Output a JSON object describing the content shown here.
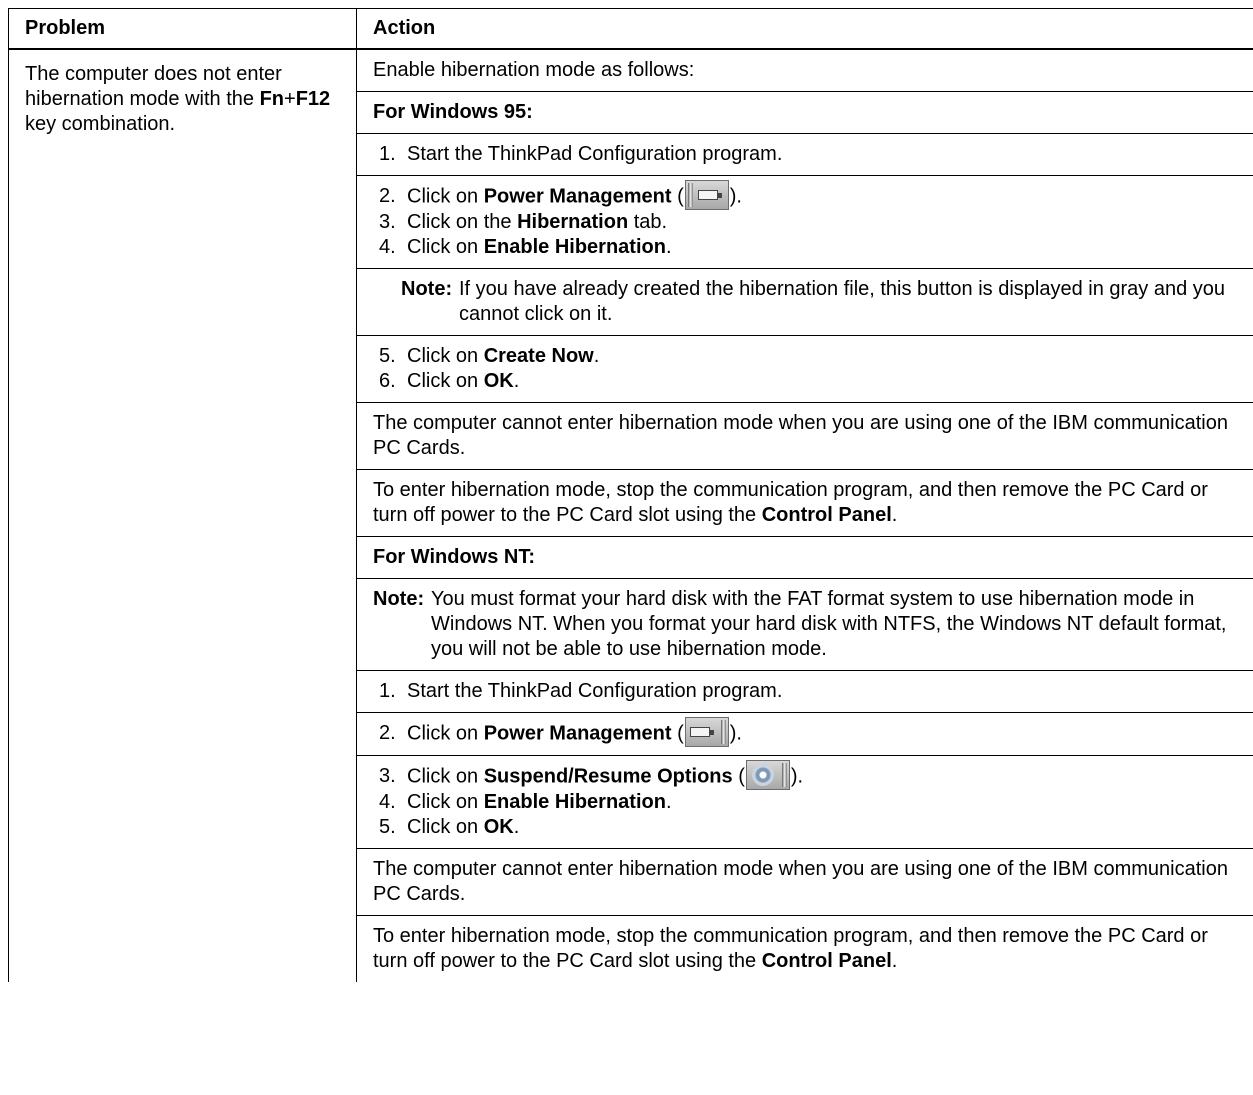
{
  "header": {
    "problem": "Problem",
    "action": "Action"
  },
  "problem": {
    "p1": "The computer does not enter hibernation mode with the ",
    "fn": "Fn",
    "plus": "+",
    "f12": "F12",
    "p2": " key combination."
  },
  "a1": {
    "text": "Enable hibernation mode as follows:"
  },
  "w95": {
    "heading": "For Windows 95:",
    "s1_num": "1.",
    "s1_text": "Start the ThinkPad Configuration program.",
    "s2_num": "2.",
    "s2_pre": "Click on ",
    "s2_bold": "Power Management",
    "s2_post_a": " (",
    "s2_post_b": ").",
    "s3_num": "3.",
    "s3_pre": "Click on the ",
    "s3_bold": "Hibernation",
    "s3_post": " tab.",
    "s4_num": "4.",
    "s4_pre": "Click on ",
    "s4_bold": "Enable Hibernation",
    "s4_post": ".",
    "note_label": "Note:",
    "note_text": "If you have already created the hibernation file, this button is displayed in gray and you cannot click on it.",
    "s5_num": "5.",
    "s5_pre": "Click on ",
    "s5_bold": "Create Now",
    "s5_post": ".",
    "s6_num": "6.",
    "s6_pre": "Click on ",
    "s6_bold": "OK",
    "s6_post": ".",
    "para1": "The computer cannot enter hibernation mode when you are using one of the IBM communication PC Cards.",
    "para2_pre": "To enter hibernation mode, stop the communication program, and then remove the PC Card or turn off power to the PC Card slot using the ",
    "para2_bold": "Control Panel",
    "para2_post": "."
  },
  "nt": {
    "heading": "For Windows NT:",
    "note_label": "Note:",
    "note_text": "You must format your hard disk with the FAT format system to use hibernation mode in Windows NT.  When you format your hard disk with NTFS, the Windows NT default format, you will not be able to use hibernation mode.",
    "s1_num": "1.",
    "s1_text": "Start the ThinkPad Configuration program.",
    "s2_num": "2.",
    "s2_pre": "Click on ",
    "s2_bold": "Power Management",
    "s2_post_a": " (",
    "s2_post_b": ").",
    "s3_num": "3.",
    "s3_pre": "Click on ",
    "s3_bold": "Suspend/Resume Options",
    "s3_post_a": " (",
    "s3_post_b": ").",
    "s4_num": "4.",
    "s4_pre": "Click on ",
    "s4_bold": "Enable Hibernation",
    "s4_post": ".",
    "s5_num": "5.",
    "s5_pre": "Click on ",
    "s5_bold": "OK",
    "s5_post": ".",
    "para1": "The computer cannot enter hibernation mode when you are using one of the IBM communication PC Cards.",
    "para2_pre": "To enter hibernation mode, stop the communication program, and then remove the PC Card or turn off power to the PC Card slot using the ",
    "para2_bold": "Control Panel",
    "para2_post": "."
  },
  "icons": {
    "power_w95": "power-management-icon",
    "power_nt": "power-management-icon",
    "suspend_nt": "suspend-resume-options-icon"
  }
}
